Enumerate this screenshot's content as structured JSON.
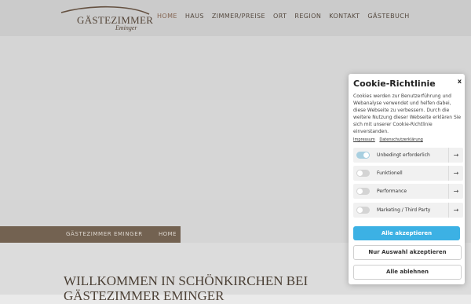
{
  "logo": {
    "main": "GÄSTEZIMMER",
    "sub": "Eminger"
  },
  "nav": {
    "items": [
      "HOME",
      "HAUS",
      "ZIMMER/PREISE",
      "ORT",
      "REGION",
      "KONTAKT",
      "GÄSTEBUCH"
    ],
    "active": "HOME"
  },
  "breadcrumb": {
    "site": "GÄSTEZIMMER EMINGER",
    "home": "HOME"
  },
  "main": {
    "heading_line1": "WILLKOMMEN IN SCHÖNKIRCHEN BEI",
    "heading_line2": "GÄSTEZIMMER EMINGER"
  },
  "cookie": {
    "title": "Cookie-Richtlinie",
    "close": "x",
    "text": "Cookies werden zur Benutzerführung und Webanalyse verwendet und helfen dabei, diese Webseite zu verbessern. Durch die weitere Nutzung dieser Webseite erklären Sie sich mit unserer Cookie-Richtlinie einverstanden.",
    "links": [
      "Impressum",
      "Datenschutzerklärung"
    ],
    "options": [
      {
        "label": "Unbedingt erforderlich",
        "enabled": true
      },
      {
        "label": "Funktionell",
        "enabled": false
      },
      {
        "label": "Performance",
        "enabled": false
      },
      {
        "label": "Marketing / Third Party",
        "enabled": false
      }
    ],
    "arrow": "→",
    "accept_all": "Alle akzeptieren",
    "accept_selection": "Nur Auswahl akzeptieren",
    "reject_all": "Alle ablehnen"
  },
  "colors": {
    "accent": "#3cb1e4",
    "brand_brown": "#7b6957"
  }
}
